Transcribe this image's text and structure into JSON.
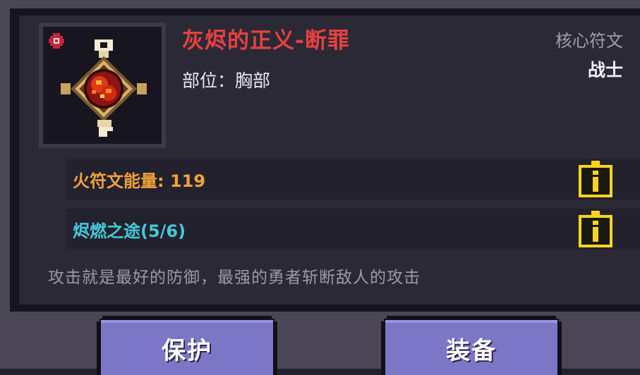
{
  "item": {
    "name": "灰烬的正义-断罪",
    "slot_line": "部位：胸部",
    "category": "核心符文",
    "class": "战士",
    "icon": "fire-rune-emblem-icon",
    "badge_icon": "red-rune-badge-icon"
  },
  "stats": [
    {
      "label": "火符文能量: 119",
      "color": "#f2a23a",
      "icon": "info-icon"
    },
    {
      "label": "烬燃之途(5/6)",
      "color": "#45c8d8",
      "icon": "info-icon"
    }
  ],
  "description": "攻击就是最好的防御，最强的勇者斩断敌人的攻击",
  "buttons": {
    "protect": "保护",
    "equip": "装备"
  },
  "colors": {
    "title": "#e8413f",
    "accent_button": "#7b76c6",
    "info_icon": "#f6d51f"
  }
}
